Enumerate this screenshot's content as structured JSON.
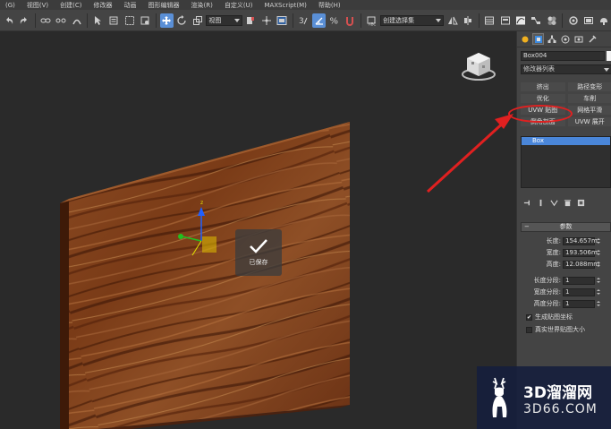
{
  "menu": {
    "items": [
      "(G)",
      "视图(V)",
      "创建(C)",
      "修改器",
      "动画",
      "图形编辑器",
      "渲染(R)",
      "自定义(U)",
      "MAXScript(M)",
      "帮助(H)"
    ]
  },
  "toolbar": {
    "view_select": "视图",
    "selection_set": "创建选择集",
    "snap_label": "3"
  },
  "viewport": {
    "toast_label": "已保存"
  },
  "panel": {
    "object_name": "Box004",
    "modifier_list": "修改器列表",
    "modifier_buttons": [
      "挤出",
      "路径变形",
      "优化",
      "车削",
      "UVW 贴图",
      "网格平滑",
      "倒角剖面",
      "UVW 展开"
    ],
    "stack_item": "Box",
    "params_title": "参数",
    "params": [
      {
        "label": "长度:",
        "value": "154.657m"
      },
      {
        "label": "宽度:",
        "value": "193.506m"
      },
      {
        "label": "高度:",
        "value": "12.088mm"
      }
    ],
    "segments": [
      {
        "label": "长度分段:",
        "value": "1"
      },
      {
        "label": "宽度分段:",
        "value": "1"
      },
      {
        "label": "高度分段:",
        "value": "1"
      }
    ],
    "check_gen_uv": "生成贴图坐标",
    "check_real_world": "真实世界贴图大小",
    "colors": {
      "highlight": "#4a86d9",
      "annotation": "#e02020"
    }
  },
  "watermark": {
    "brand": "3D溜溜网",
    "site": "3D66.COM"
  }
}
